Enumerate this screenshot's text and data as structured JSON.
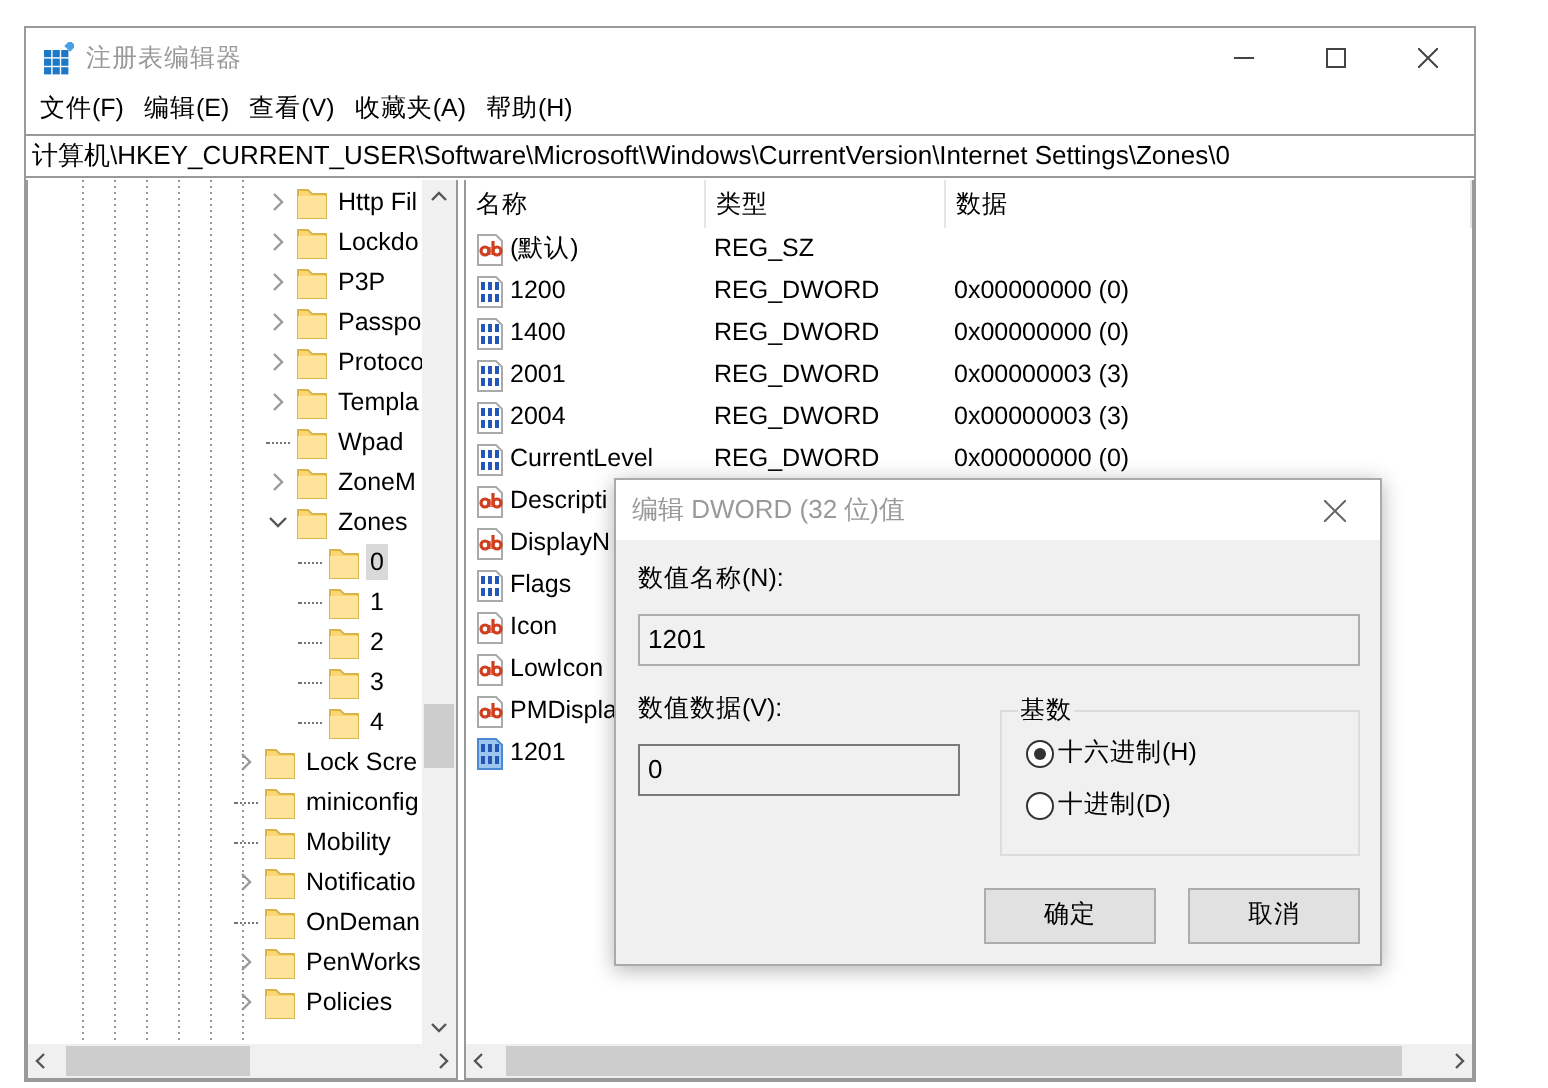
{
  "window": {
    "title": "注册表编辑器"
  },
  "menu": [
    {
      "label": "文件(F)"
    },
    {
      "label": "编辑(E)"
    },
    {
      "label": "查看(V)"
    },
    {
      "label": "收藏夹(A)"
    },
    {
      "label": "帮助(H)"
    }
  ],
  "address": "计算机\\HKEY_CURRENT_USER\\Software\\Microsoft\\Windows\\CurrentVersion\\Internet Settings\\Zones\\0",
  "tree": {
    "items": [
      {
        "children": [
          {
            "label": "Http Fil",
            "expandable": true,
            "expanded": false,
            "selected": false
          },
          {
            "label": "Lockdo",
            "expandable": true,
            "expanded": false,
            "selected": false
          },
          {
            "label": "P3P",
            "expandable": true,
            "expanded": false,
            "selected": false
          },
          {
            "label": "Passpo",
            "expandable": true,
            "expanded": false,
            "selected": false
          },
          {
            "label": "Protoco",
            "expandable": true,
            "expanded": false,
            "selected": false
          },
          {
            "label": "Templa",
            "expandable": true,
            "expanded": false,
            "selected": false
          },
          {
            "label": "Wpad",
            "expandable": false,
            "selected": false
          },
          {
            "label": "ZoneM",
            "expandable": true,
            "expanded": false,
            "selected": false
          },
          {
            "label": "Zones",
            "expandable": true,
            "expanded": true,
            "selected": false,
            "children": [
              {
                "label": "0",
                "expandable": false,
                "selected": true
              },
              {
                "label": "1",
                "expandable": false,
                "selected": false
              },
              {
                "label": "2",
                "expandable": false,
                "selected": false
              },
              {
                "label": "3",
                "expandable": false,
                "selected": false
              },
              {
                "label": "4",
                "expandable": false,
                "selected": false
              }
            ]
          }
        ]
      },
      {
        "label": "Lock Scre",
        "expandable": true,
        "expanded": false,
        "selected": false
      },
      {
        "label": "miniconfig",
        "expandable": false,
        "selected": false
      },
      {
        "label": "Mobility",
        "expandable": false,
        "selected": false
      },
      {
        "label": "Notificatio",
        "expandable": true,
        "expanded": false,
        "selected": false
      },
      {
        "label": "OnDeman",
        "expandable": false,
        "selected": false
      },
      {
        "label": "PenWorks",
        "expandable": true,
        "expanded": false,
        "selected": false
      },
      {
        "label": "Policies",
        "expandable": true,
        "expanded": false,
        "selected": false
      }
    ]
  },
  "table": {
    "columns": [
      "名称",
      "类型",
      "数据"
    ],
    "rows": [
      {
        "kind": "string",
        "name": "(默认)",
        "type": "REG_SZ",
        "selected": false
      },
      {
        "kind": "dword",
        "name": "1200",
        "type": "REG_DWORD",
        "data": "0x00000000 (0)",
        "selected": false
      },
      {
        "kind": "dword",
        "name": "1400",
        "type": "REG_DWORD",
        "data": "0x00000000 (0)",
        "selected": false
      },
      {
        "kind": "dword",
        "name": "2001",
        "type": "REG_DWORD",
        "data": "0x00000003 (3)",
        "selected": false
      },
      {
        "kind": "dword",
        "name": "2004",
        "type": "REG_DWORD",
        "data": "0x00000003 (3)",
        "selected": false
      },
      {
        "kind": "dword",
        "name": "CurrentLevel",
        "type": "REG_DWORD",
        "data": "0x00000000 (0)",
        "selected": false
      },
      {
        "kind": "string",
        "name": "Descripti",
        "selected": false
      },
      {
        "kind": "string",
        "name": "DisplayN",
        "selected": false
      },
      {
        "kind": "dword",
        "name": "Flags",
        "selected": false
      },
      {
        "kind": "string",
        "name": "Icon",
        "selected": false
      },
      {
        "kind": "string",
        "name": "LowIcon",
        "selected": false
      },
      {
        "kind": "string",
        "name": "PMDispla",
        "selected": false
      },
      {
        "kind": "dword",
        "name": "1201",
        "selected": true
      }
    ]
  },
  "dialog": {
    "title": "编辑 DWORD (32 位)值",
    "name_label": "数值名称(N):",
    "name_value": "1201",
    "data_label": "数值数据(V):",
    "data_value": "0",
    "base_label": "基数",
    "radios": [
      {
        "label": "十六进制(H)",
        "selected": true
      },
      {
        "label": "十进制(D)",
        "selected": false
      }
    ],
    "buttons": [
      "确定",
      "取消"
    ]
  }
}
